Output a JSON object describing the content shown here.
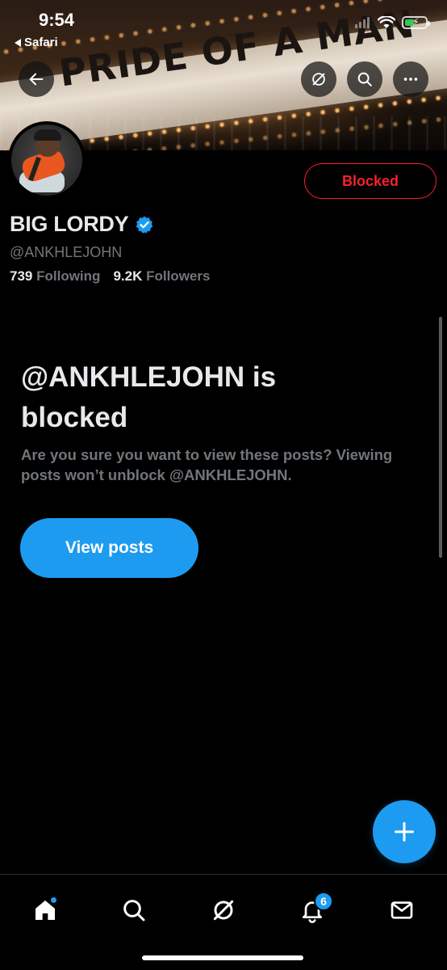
{
  "status_bar": {
    "time": "9:54",
    "back_app": "Safari"
  },
  "banner": {
    "marquee_text": "PRIDE OF A MAN"
  },
  "profile": {
    "name": "BIG LORDY",
    "handle": "@ANKHLEJOHN",
    "following_count": "739",
    "following_label": "Following",
    "followers_count": "9.2K",
    "followers_label": "Followers",
    "blocked_button_label": "Blocked",
    "verified": true
  },
  "block_notice": {
    "title": "@ANKHLEJOHN is blocked",
    "description": "Are you sure you want to view these posts? Viewing posts won’t unblock @ANKHLEJOHN.",
    "view_posts_label": "View posts"
  },
  "bottom_nav": {
    "items": [
      "home-icon",
      "search-icon",
      "grok-icon",
      "notifications-icon",
      "messages-icon"
    ],
    "notifications_badge": "6"
  },
  "colors": {
    "accent": "#1d9bf0",
    "blocked_red": "#f4212e",
    "background": "#000000",
    "secondary_text": "#71767b"
  }
}
